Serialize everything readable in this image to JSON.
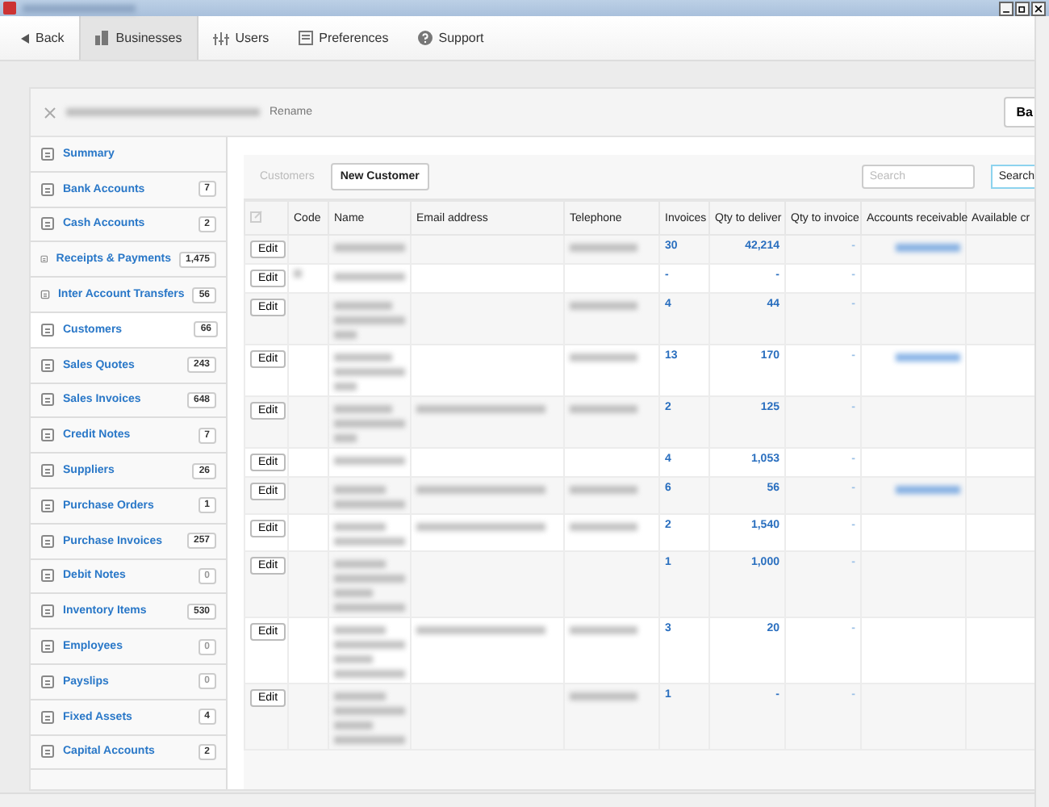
{
  "nav": {
    "back": "Back",
    "tabs": [
      {
        "label": "Businesses",
        "selected": true
      },
      {
        "label": "Users",
        "selected": false
      },
      {
        "label": "Preferences",
        "selected": false
      },
      {
        "label": "Support",
        "selected": false
      }
    ]
  },
  "business": {
    "rename": "Rename",
    "button": "Ba"
  },
  "sidebar": {
    "items": [
      {
        "label": "Summary",
        "selected": false
      },
      {
        "label": "Bank Accounts",
        "count": "7",
        "muted": false,
        "selected": false
      },
      {
        "label": "Cash Accounts",
        "count": "2",
        "muted": false,
        "selected": false
      },
      {
        "label": "Receipts & Payments",
        "count": "1,475",
        "muted": false,
        "selected": false
      },
      {
        "label": "Inter Account Transfers",
        "count": "56",
        "muted": false,
        "selected": false
      },
      {
        "label": "Customers",
        "count": "66",
        "muted": false,
        "selected": true
      },
      {
        "label": "Sales Quotes",
        "count": "243",
        "muted": false,
        "selected": false
      },
      {
        "label": "Sales Invoices",
        "count": "648",
        "muted": false,
        "selected": false
      },
      {
        "label": "Credit Notes",
        "count": "7",
        "muted": false,
        "selected": false
      },
      {
        "label": "Suppliers",
        "count": "26",
        "muted": false,
        "selected": false
      },
      {
        "label": "Purchase Orders",
        "count": "1",
        "muted": false,
        "selected": false
      },
      {
        "label": "Purchase Invoices",
        "count": "257",
        "muted": false,
        "selected": false
      },
      {
        "label": "Debit Notes",
        "count": "0",
        "muted": true,
        "selected": false
      },
      {
        "label": "Inventory Items",
        "count": "530",
        "muted": false,
        "selected": false
      },
      {
        "label": "Employees",
        "count": "0",
        "muted": true,
        "selected": false
      },
      {
        "label": "Payslips",
        "count": "0",
        "muted": true,
        "selected": false
      },
      {
        "label": "Fixed Assets",
        "count": "4",
        "muted": false,
        "selected": false
      },
      {
        "label": "Capital Accounts",
        "count": "2",
        "muted": false,
        "selected": false
      }
    ]
  },
  "toolbar": {
    "title": "Customers",
    "new_button": "New Customer",
    "search": {
      "placeholder": "Search"
    },
    "search_button": "Search"
  },
  "table": {
    "columns": [
      "Code",
      "Name",
      "Email address",
      "Telephone",
      "Invoices",
      "Qty to deliver",
      "Qty to invoice",
      "Accounts receivable",
      "Available cr"
    ],
    "rows": [
      {
        "kind": "single",
        "edit": "Edit",
        "redacted": {
          "code": false,
          "email": false,
          "telephone": true,
          "accounts_receivable": true
        },
        "invoices": "30",
        "deliver": "42,214",
        "to_invoice": "-"
      },
      {
        "kind": "single",
        "edit": "Edit",
        "redacted": {
          "code": true,
          "email": false,
          "telephone": false,
          "accounts_receivable": false
        },
        "invoices": "-",
        "deliver": "-",
        "to_invoice": "-"
      },
      {
        "kind": "triple",
        "edit": "Edit",
        "redacted": {
          "code": false,
          "email": false,
          "telephone": true,
          "accounts_receivable": false
        },
        "invoices": "4",
        "deliver": "44",
        "to_invoice": "-"
      },
      {
        "kind": "triple",
        "edit": "Edit",
        "redacted": {
          "code": false,
          "email": false,
          "telephone": true,
          "accounts_receivable": true
        },
        "invoices": "13",
        "deliver": "170",
        "to_invoice": "-"
      },
      {
        "kind": "triple",
        "edit": "Edit",
        "redacted": {
          "code": false,
          "email": true,
          "telephone": true,
          "accounts_receivable": false
        },
        "invoices": "2",
        "deliver": "125",
        "to_invoice": "-"
      },
      {
        "kind": "single",
        "edit": "Edit",
        "redacted": {
          "code": false,
          "email": false,
          "telephone": false,
          "accounts_receivable": false
        },
        "invoices": "4",
        "deliver": "1,053",
        "to_invoice": "-"
      },
      {
        "kind": "double",
        "edit": "Edit",
        "redacted": {
          "code": false,
          "email": true,
          "telephone": true,
          "accounts_receivable": true
        },
        "invoices": "6",
        "deliver": "56",
        "to_invoice": "-"
      },
      {
        "kind": "double",
        "edit": "Edit",
        "redacted": {
          "code": false,
          "email": true,
          "telephone": true,
          "accounts_receivable": false
        },
        "invoices": "2",
        "deliver": "1,540",
        "to_invoice": "-"
      },
      {
        "kind": "quad",
        "edit": "Edit",
        "redacted": {
          "code": false,
          "email": false,
          "telephone": false,
          "accounts_receivable": false
        },
        "invoices": "1",
        "deliver": "1,000",
        "to_invoice": "-"
      },
      {
        "kind": "quad",
        "edit": "Edit",
        "redacted": {
          "code": false,
          "email": true,
          "telephone": true,
          "accounts_receivable": false
        },
        "invoices": "3",
        "deliver": "20",
        "to_invoice": "-"
      },
      {
        "kind": "quad",
        "edit": "Edit",
        "redacted": {
          "code": false,
          "email": false,
          "telephone": true,
          "accounts_receivable": false
        },
        "invoices": "1",
        "deliver": "-",
        "to_invoice": "-"
      }
    ]
  }
}
